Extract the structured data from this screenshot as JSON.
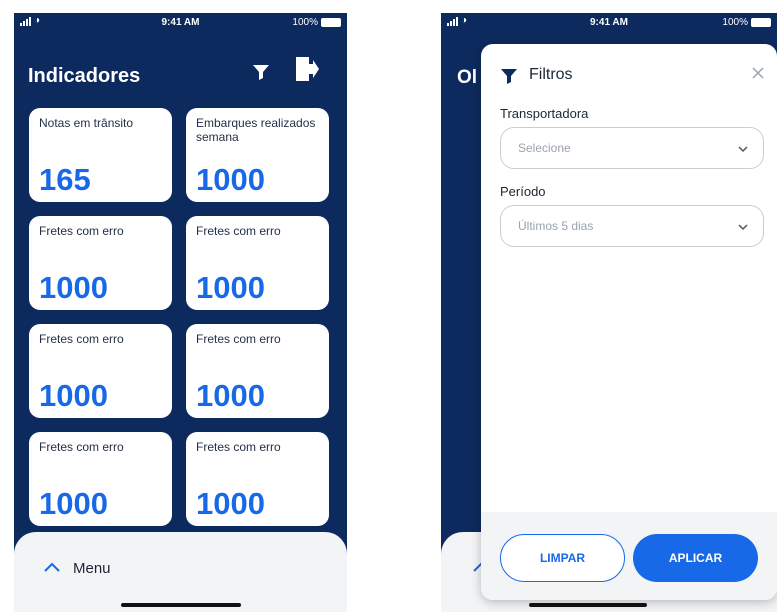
{
  "status": {
    "time": "9:41 AM",
    "battery": "100%"
  },
  "dashboard": {
    "title": "Indicadores",
    "cards": [
      {
        "label": "Notas em trânsito",
        "value": "165"
      },
      {
        "label": "Embarques realizados semana",
        "value": "1000"
      },
      {
        "label": "Fretes com erro",
        "value": "1000"
      },
      {
        "label": "Fretes com erro",
        "value": "1000"
      },
      {
        "label": "Fretes com erro",
        "value": "1000"
      },
      {
        "label": "Fretes com erro",
        "value": "1000"
      },
      {
        "label": "Fretes com erro",
        "value": "1000"
      },
      {
        "label": "Fretes com erro",
        "value": "1000"
      }
    ],
    "menu_label": "Menu"
  },
  "background": {
    "heading_partial": "Ol"
  },
  "filter_modal": {
    "title": "Filtros",
    "carrier_label": "Transportadora",
    "carrier_placeholder": "Selecione",
    "period_label": "Período",
    "period_value": "Últimos 5 dias",
    "clear_label": "LIMPAR",
    "apply_label": "APLICAR"
  },
  "colors": {
    "navy": "#0d2a5e",
    "accent": "#1769e8"
  },
  "icons": [
    "filter-icon",
    "exit-icon",
    "chevron-up-icon",
    "chevron-down-icon",
    "close-icon"
  ]
}
